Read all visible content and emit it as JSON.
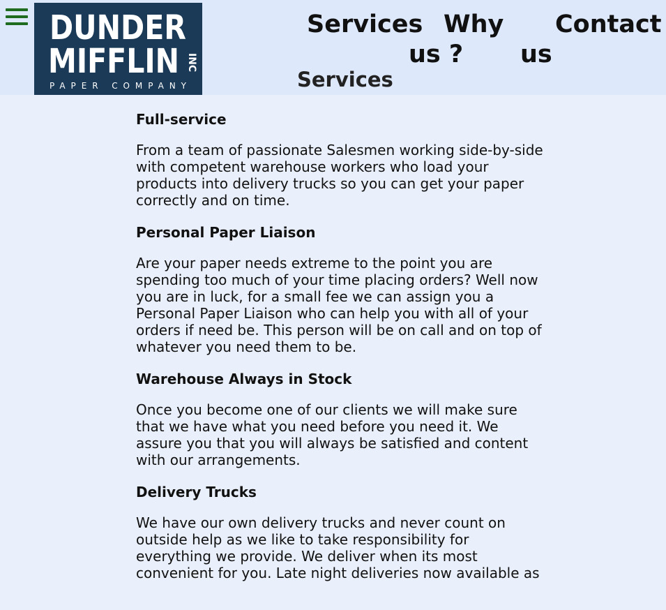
{
  "header": {
    "logo": {
      "line1": "DUNDER",
      "line2": "MIFFLIN",
      "inc": "INC",
      "tagline": "PAPER COMPANY"
    },
    "nav": {
      "services": "Services",
      "why_line1": "Why",
      "why_line2": "us ?",
      "contact_line1": "Contact",
      "contact_line2": "us"
    },
    "page_title": "Services"
  },
  "sections": [
    {
      "title": "Full-service",
      "body": "From a team of passionate Salesmen working side-by-side with competent warehouse workers who load your products into delivery trucks so you can get your paper correctly and on time."
    },
    {
      "title": "Personal Paper Liaison",
      "body": "Are your paper needs extreme to the point you are spending too much of your time placing orders? Well now you are in luck, for a small fee we can assign you a Personal Paper Liaison who can help you with all of your orders if need be. This person will be on call and on top of whatever you need them to be."
    },
    {
      "title": "Warehouse Always in Stock",
      "body": "Once you become one of our clients we will make sure that we have what you need before you need it. We assure you that you will always be satisfied and content with our arrangements."
    },
    {
      "title": "Delivery Trucks",
      "body": "We have our own delivery trucks and never count on outside help as we like to take responsibility for everything we provide. We deliver when its most convenient for you. Late night deliveries now available as"
    }
  ],
  "colors": {
    "header_bg": "#dde8fa",
    "page_bg": "#eaf0fb",
    "logo_bg": "#1b3a58",
    "menu_icon": "#1f6b1f"
  },
  "icons": {
    "menu": "hamburger-menu-icon"
  }
}
